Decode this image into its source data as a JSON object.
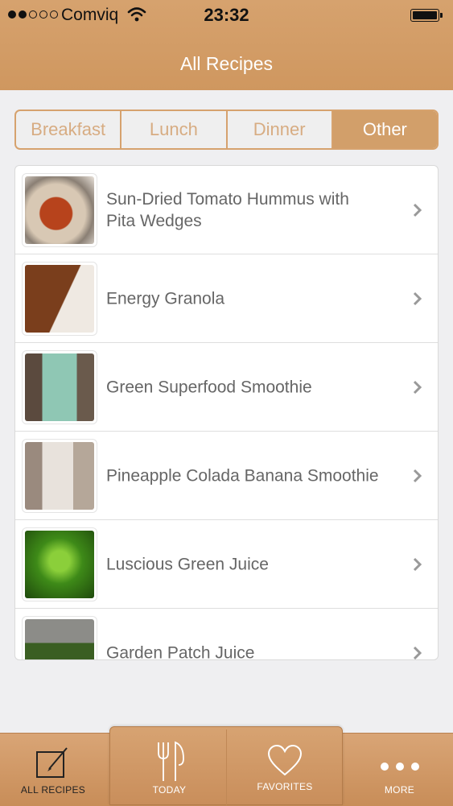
{
  "status_bar": {
    "carrier": "Comviq",
    "time": "23:32"
  },
  "nav": {
    "title": "All Recipes"
  },
  "segments": [
    {
      "label": "Breakfast",
      "selected": false
    },
    {
      "label": "Lunch",
      "selected": false
    },
    {
      "label": "Dinner",
      "selected": false
    },
    {
      "label": "Other",
      "selected": true
    }
  ],
  "recipes": [
    {
      "title": "Sun-Dried Tomato Hummus with Pita Wedges",
      "icon": "chevron-right-icon"
    },
    {
      "title": "Energy Granola",
      "icon": "chevron-right-icon"
    },
    {
      "title": "Green Superfood Smoothie",
      "icon": "chevron-right-icon"
    },
    {
      "title": "Pineapple Colada Banana Smoothie",
      "icon": "chevron-right-icon"
    },
    {
      "title": "Luscious Green Juice",
      "icon": "chevron-right-icon"
    },
    {
      "title": "Garden Patch Juice",
      "icon": "chevron-right-icon"
    }
  ],
  "tabbar": {
    "tabs": [
      {
        "label": "ALL RECIPES",
        "icon": "edit-icon",
        "selected": true
      },
      {
        "label": "TODAY",
        "icon": "fork-knife-icon",
        "selected": false
      },
      {
        "label": "FAVORITES",
        "icon": "heart-icon",
        "selected": false
      },
      {
        "label": "MORE",
        "icon": "more-icon",
        "selected": false
      }
    ]
  },
  "colors": {
    "accent": "#d29f6a",
    "background": "#efeff1"
  }
}
